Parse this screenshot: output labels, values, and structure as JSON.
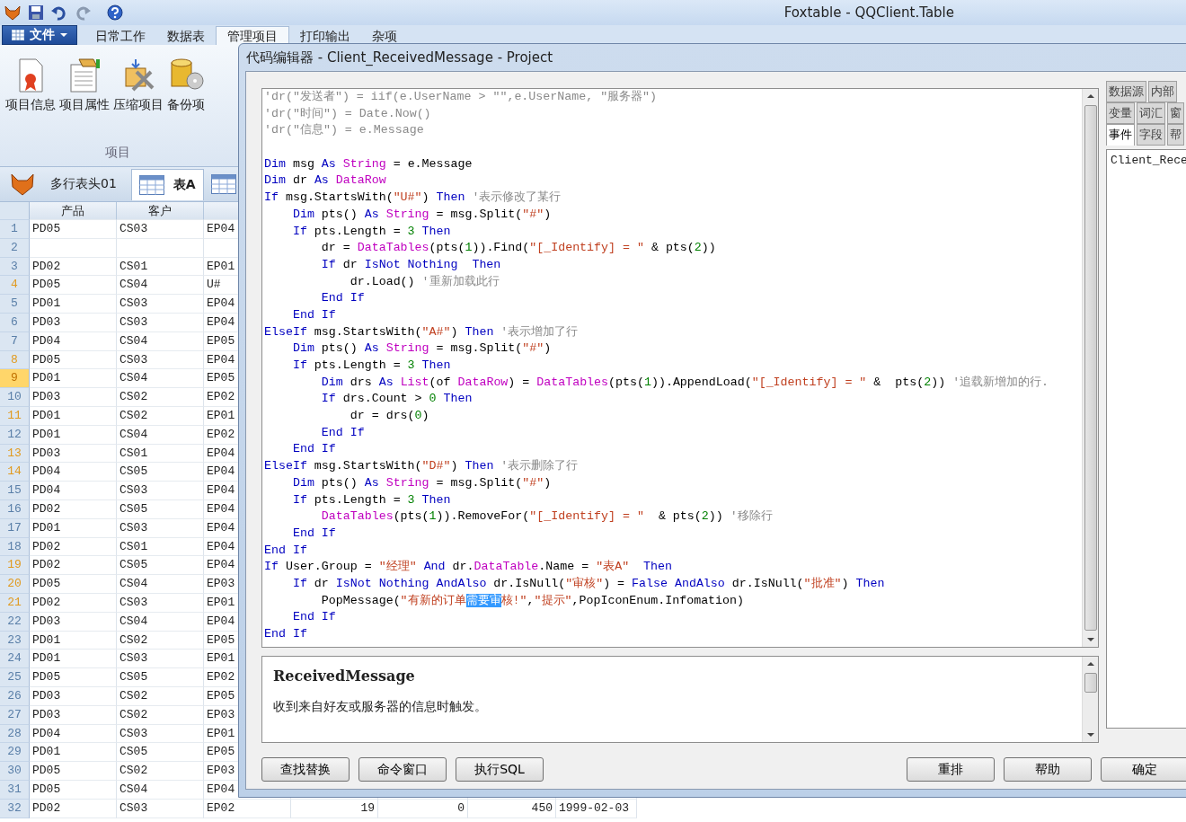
{
  "app": {
    "title": "Foxtable - QQClient.Table",
    "file_menu": "文件"
  },
  "ribbon_tabs": [
    {
      "label": "日常工作",
      "selected": false
    },
    {
      "label": "数据表",
      "selected": false
    },
    {
      "label": "管理项目",
      "selected": true
    },
    {
      "label": "打印输出",
      "selected": false
    },
    {
      "label": "杂项",
      "selected": false
    }
  ],
  "ribbon_group": {
    "label": "项目",
    "buttons": [
      "项目信息",
      "项目属性",
      "压缩项目",
      "备份项"
    ]
  },
  "table_tabs": [
    {
      "label": "多行表头01",
      "selected": false
    },
    {
      "label": "表A",
      "selected": true
    }
  ],
  "grid": {
    "columns": [
      "产品",
      "客户"
    ],
    "rows": [
      {
        "number": "1",
        "marked": false,
        "selected": false,
        "cells": [
          "PD05",
          "CS03",
          "EP04"
        ]
      },
      {
        "number": "2",
        "marked": false,
        "selected": false,
        "cells": []
      },
      {
        "number": "3",
        "marked": false,
        "selected": false,
        "cells": [
          "PD02",
          "CS01",
          "EP01"
        ]
      },
      {
        "number": "4",
        "marked": true,
        "selected": false,
        "cells": [
          "PD05",
          "CS04",
          "U#"
        ]
      },
      {
        "number": "5",
        "marked": false,
        "selected": false,
        "cells": [
          "PD01",
          "CS03",
          "EP04"
        ]
      },
      {
        "number": "6",
        "marked": false,
        "selected": false,
        "cells": [
          "PD03",
          "CS03",
          "EP04"
        ]
      },
      {
        "number": "7",
        "marked": false,
        "selected": false,
        "cells": [
          "PD04",
          "CS04",
          "EP05"
        ]
      },
      {
        "number": "8",
        "marked": true,
        "selected": false,
        "cells": [
          "PD05",
          "CS03",
          "EP04"
        ]
      },
      {
        "number": "9",
        "marked": true,
        "selected": true,
        "cells": [
          "PD01",
          "CS04",
          "EP05"
        ]
      },
      {
        "number": "10",
        "marked": false,
        "selected": false,
        "cells": [
          "PD03",
          "CS02",
          "EP02"
        ]
      },
      {
        "number": "11",
        "marked": true,
        "selected": false,
        "cells": [
          "PD01",
          "CS02",
          "EP01"
        ]
      },
      {
        "number": "12",
        "marked": false,
        "selected": false,
        "cells": [
          "PD01",
          "CS04",
          "EP02"
        ]
      },
      {
        "number": "13",
        "marked": true,
        "selected": false,
        "cells": [
          "PD03",
          "CS01",
          "EP04"
        ]
      },
      {
        "number": "14",
        "marked": true,
        "selected": false,
        "cells": [
          "PD04",
          "CS05",
          "EP04"
        ]
      },
      {
        "number": "15",
        "marked": false,
        "selected": false,
        "cells": [
          "PD04",
          "CS03",
          "EP04"
        ]
      },
      {
        "number": "16",
        "marked": false,
        "selected": false,
        "cells": [
          "PD02",
          "CS05",
          "EP04"
        ]
      },
      {
        "number": "17",
        "marked": false,
        "selected": false,
        "cells": [
          "PD01",
          "CS03",
          "EP04"
        ]
      },
      {
        "number": "18",
        "marked": false,
        "selected": false,
        "cells": [
          "PD02",
          "CS01",
          "EP04"
        ]
      },
      {
        "number": "19",
        "marked": true,
        "selected": false,
        "cells": [
          "PD02",
          "CS05",
          "EP04"
        ]
      },
      {
        "number": "20",
        "marked": true,
        "selected": false,
        "cells": [
          "PD05",
          "CS04",
          "EP03"
        ]
      },
      {
        "number": "21",
        "marked": true,
        "selected": false,
        "cells": [
          "PD02",
          "CS03",
          "EP01"
        ]
      },
      {
        "number": "22",
        "marked": false,
        "selected": false,
        "cells": [
          "PD03",
          "CS04",
          "EP04"
        ]
      },
      {
        "number": "23",
        "marked": false,
        "selected": false,
        "cells": [
          "PD01",
          "CS02",
          "EP05"
        ]
      },
      {
        "number": "24",
        "marked": false,
        "selected": false,
        "cells": [
          "PD01",
          "CS03",
          "EP01"
        ]
      },
      {
        "number": "25",
        "marked": false,
        "selected": false,
        "cells": [
          "PD05",
          "CS05",
          "EP02"
        ]
      },
      {
        "number": "26",
        "marked": false,
        "selected": false,
        "cells": [
          "PD03",
          "CS02",
          "EP05"
        ]
      },
      {
        "number": "27",
        "marked": false,
        "selected": false,
        "cells": [
          "PD03",
          "CS02",
          "EP03"
        ]
      },
      {
        "number": "28",
        "marked": false,
        "selected": false,
        "cells": [
          "PD04",
          "CS03",
          "EP01"
        ]
      },
      {
        "number": "29",
        "marked": false,
        "selected": false,
        "cells": [
          "PD01",
          "CS05",
          "EP05"
        ]
      },
      {
        "number": "30",
        "marked": false,
        "selected": false,
        "cells": [
          "PD05",
          "CS02",
          "EP03"
        ]
      },
      {
        "number": "31",
        "marked": false,
        "selected": false,
        "cells": [
          "PD05",
          "CS04",
          "EP04"
        ]
      },
      {
        "number": "32",
        "marked": false,
        "selected": false,
        "cells": [
          "PD02",
          "CS03",
          "EP02",
          "19",
          "0",
          "450",
          "1999-02-03"
        ]
      }
    ]
  },
  "dialog": {
    "title": "代码编辑器 - Client_ReceivedMessage - Project",
    "code_lines": [
      {
        "kind": "code",
        "tokens": [
          {
            "text": "'dr(\"发送者\") = iif(e.UserName > \"\",e.UserName, \"服务器\")",
            "kind": "comment"
          }
        ]
      },
      {
        "kind": "code",
        "tokens": [
          {
            "text": "'dr(\"时间\") = Date.Now()",
            "kind": "comment"
          }
        ]
      },
      {
        "kind": "code",
        "tokens": [
          {
            "text": "'dr(\"信息\") = e.Message",
            "kind": "comment"
          }
        ]
      },
      {
        "kind": "blank"
      },
      {
        "kind": "code",
        "tokens": [
          {
            "text": "Dim",
            "kind": "keyword"
          },
          {
            "text": " msg ",
            "kind": "plain"
          },
          {
            "text": "As",
            "kind": "keyword"
          },
          {
            "text": " String",
            "kind": "type"
          },
          {
            "text": " = e.Message",
            "kind": "plain"
          }
        ]
      },
      {
        "kind": "code",
        "tokens": [
          {
            "text": "Dim",
            "kind": "keyword"
          },
          {
            "text": " dr ",
            "kind": "plain"
          },
          {
            "text": "As",
            "kind": "keyword"
          },
          {
            "text": " DataRow",
            "kind": "type"
          }
        ]
      },
      {
        "kind": "code",
        "tokens": [
          {
            "text": "If",
            "kind": "keyword"
          },
          {
            "text": " msg.StartsWith(",
            "kind": "plain"
          },
          {
            "text": "\"U#\"",
            "kind": "string"
          },
          {
            "text": ")",
            "kind": "plain"
          },
          {
            "text": " Then",
            "kind": "keyword"
          },
          {
            "text": " '表示修改了某行",
            "kind": "comment"
          }
        ]
      },
      {
        "kind": "code",
        "tokens": [
          {
            "text": "    Dim",
            "kind": "keyword"
          },
          {
            "text": " pts() ",
            "kind": "plain"
          },
          {
            "text": "As",
            "kind": "keyword"
          },
          {
            "text": " String",
            "kind": "type"
          },
          {
            "text": " = msg.Split(",
            "kind": "plain"
          },
          {
            "text": "\"#\"",
            "kind": "string"
          },
          {
            "text": ")",
            "kind": "plain"
          }
        ]
      },
      {
        "kind": "code",
        "tokens": [
          {
            "text": "    If",
            "kind": "keyword"
          },
          {
            "text": " pts.Length = ",
            "kind": "plain"
          },
          {
            "text": "3",
            "kind": "number"
          },
          {
            "text": " Then",
            "kind": "keyword"
          }
        ]
      },
      {
        "kind": "code",
        "tokens": [
          {
            "text": "        dr = ",
            "kind": "plain"
          },
          {
            "text": "DataTables",
            "kind": "type"
          },
          {
            "text": "(pts(",
            "kind": "plain"
          },
          {
            "text": "1",
            "kind": "number"
          },
          {
            "text": ")).Find(",
            "kind": "plain"
          },
          {
            "text": "\"[_Identify] = \"",
            "kind": "string"
          },
          {
            "text": " & pts(",
            "kind": "plain"
          },
          {
            "text": "2",
            "kind": "number"
          },
          {
            "text": "))",
            "kind": "plain"
          }
        ]
      },
      {
        "kind": "code",
        "tokens": [
          {
            "text": "        If",
            "kind": "keyword"
          },
          {
            "text": " dr ",
            "kind": "plain"
          },
          {
            "text": "IsNot Nothing  Then",
            "kind": "keyword"
          }
        ]
      },
      {
        "kind": "code",
        "tokens": [
          {
            "text": "            dr.Load() ",
            "kind": "plain"
          },
          {
            "text": "'重新加载此行",
            "kind": "comment"
          }
        ]
      },
      {
        "kind": "code",
        "tokens": [
          {
            "text": "        End If",
            "kind": "keyword"
          }
        ]
      },
      {
        "kind": "code",
        "tokens": [
          {
            "text": "    End If",
            "kind": "keyword"
          }
        ]
      },
      {
        "kind": "code",
        "tokens": [
          {
            "text": "ElseIf",
            "kind": "keyword"
          },
          {
            "text": " msg.StartsWith(",
            "kind": "plain"
          },
          {
            "text": "\"A#\"",
            "kind": "string"
          },
          {
            "text": ") ",
            "kind": "plain"
          },
          {
            "text": "Then",
            "kind": "keyword"
          },
          {
            "text": " '表示增加了行",
            "kind": "comment"
          }
        ]
      },
      {
        "kind": "code",
        "tokens": [
          {
            "text": "    Dim",
            "kind": "keyword"
          },
          {
            "text": " pts() ",
            "kind": "plain"
          },
          {
            "text": "As",
            "kind": "keyword"
          },
          {
            "text": " String",
            "kind": "type"
          },
          {
            "text": " = msg.Split(",
            "kind": "plain"
          },
          {
            "text": "\"#\"",
            "kind": "string"
          },
          {
            "text": ")",
            "kind": "plain"
          }
        ]
      },
      {
        "kind": "code",
        "tokens": [
          {
            "text": "    If",
            "kind": "keyword"
          },
          {
            "text": " pts.Length = ",
            "kind": "plain"
          },
          {
            "text": "3",
            "kind": "number"
          },
          {
            "text": " Then",
            "kind": "keyword"
          }
        ]
      },
      {
        "kind": "code",
        "tokens": [
          {
            "text": "        Dim",
            "kind": "keyword"
          },
          {
            "text": " drs ",
            "kind": "plain"
          },
          {
            "text": "As",
            "kind": "keyword"
          },
          {
            "text": " List",
            "kind": "type"
          },
          {
            "text": "(of ",
            "kind": "plain"
          },
          {
            "text": "DataRow",
            "kind": "type"
          },
          {
            "text": ") = ",
            "kind": "plain"
          },
          {
            "text": "DataTables",
            "kind": "type"
          },
          {
            "text": "(pts(",
            "kind": "plain"
          },
          {
            "text": "1",
            "kind": "number"
          },
          {
            "text": ")).AppendLoad(",
            "kind": "plain"
          },
          {
            "text": "\"[_Identify] = \"",
            "kind": "string"
          },
          {
            "text": " &  pts(",
            "kind": "plain"
          },
          {
            "text": "2",
            "kind": "number"
          },
          {
            "text": ")) ",
            "kind": "plain"
          },
          {
            "text": "'追载新增加的行.",
            "kind": "comment"
          }
        ]
      },
      {
        "kind": "code",
        "tokens": [
          {
            "text": "        If",
            "kind": "keyword"
          },
          {
            "text": " drs.Count > ",
            "kind": "plain"
          },
          {
            "text": "0",
            "kind": "number"
          },
          {
            "text": " Then",
            "kind": "keyword"
          }
        ]
      },
      {
        "kind": "code",
        "tokens": [
          {
            "text": "            dr = drs(",
            "kind": "plain"
          },
          {
            "text": "0",
            "kind": "number"
          },
          {
            "text": ")",
            "kind": "plain"
          }
        ]
      },
      {
        "kind": "code",
        "tokens": [
          {
            "text": "        End If",
            "kind": "keyword"
          }
        ]
      },
      {
        "kind": "code",
        "tokens": [
          {
            "text": "    End If",
            "kind": "keyword"
          }
        ]
      },
      {
        "kind": "code",
        "tokens": [
          {
            "text": "ElseIf",
            "kind": "keyword"
          },
          {
            "text": " msg.StartsWith(",
            "kind": "plain"
          },
          {
            "text": "\"D#\"",
            "kind": "string"
          },
          {
            "text": ") ",
            "kind": "plain"
          },
          {
            "text": "Then",
            "kind": "keyword"
          },
          {
            "text": " '表示删除了行",
            "kind": "comment"
          }
        ]
      },
      {
        "kind": "code",
        "tokens": [
          {
            "text": "    Dim",
            "kind": "keyword"
          },
          {
            "text": " pts() ",
            "kind": "plain"
          },
          {
            "text": "As",
            "kind": "keyword"
          },
          {
            "text": " String",
            "kind": "type"
          },
          {
            "text": " = msg.Split(",
            "kind": "plain"
          },
          {
            "text": "\"#\"",
            "kind": "string"
          },
          {
            "text": ")",
            "kind": "plain"
          }
        ]
      },
      {
        "kind": "code",
        "tokens": [
          {
            "text": "    If",
            "kind": "keyword"
          },
          {
            "text": " pts.Length = ",
            "kind": "plain"
          },
          {
            "text": "3",
            "kind": "number"
          },
          {
            "text": " Then",
            "kind": "keyword"
          }
        ]
      },
      {
        "kind": "code",
        "tokens": [
          {
            "text": "        DataTables",
            "kind": "type"
          },
          {
            "text": "(pts(",
            "kind": "plain"
          },
          {
            "text": "1",
            "kind": "number"
          },
          {
            "text": ")).RemoveFor(",
            "kind": "plain"
          },
          {
            "text": "\"[_Identify] = \"",
            "kind": "string"
          },
          {
            "text": "  & pts(",
            "kind": "plain"
          },
          {
            "text": "2",
            "kind": "number"
          },
          {
            "text": ")) ",
            "kind": "plain"
          },
          {
            "text": "'移除行",
            "kind": "comment"
          }
        ]
      },
      {
        "kind": "code",
        "tokens": [
          {
            "text": "    End If",
            "kind": "keyword"
          }
        ]
      },
      {
        "kind": "code",
        "tokens": [
          {
            "text": "End If",
            "kind": "keyword"
          }
        ]
      },
      {
        "kind": "code",
        "tokens": [
          {
            "text": "If",
            "kind": "keyword"
          },
          {
            "text": " User.Group = ",
            "kind": "plain"
          },
          {
            "text": "\"经理\"",
            "kind": "string"
          },
          {
            "text": " And",
            "kind": "keyword"
          },
          {
            "text": " dr.",
            "kind": "plain"
          },
          {
            "text": "DataTable",
            "kind": "type"
          },
          {
            "text": ".Name = ",
            "kind": "plain"
          },
          {
            "text": "\"表A\"",
            "kind": "string"
          },
          {
            "text": "  Then",
            "kind": "keyword"
          }
        ]
      },
      {
        "kind": "code",
        "tokens": [
          {
            "text": "    If",
            "kind": "keyword"
          },
          {
            "text": " dr ",
            "kind": "plain"
          },
          {
            "text": "IsNot Nothing AndAlso",
            "kind": "keyword"
          },
          {
            "text": " dr.IsNull(",
            "kind": "plain"
          },
          {
            "text": "\"审核\"",
            "kind": "string"
          },
          {
            "text": ") = ",
            "kind": "plain"
          },
          {
            "text": "False AndAlso",
            "kind": "keyword"
          },
          {
            "text": " dr.IsNull(",
            "kind": "plain"
          },
          {
            "text": "\"批准\"",
            "kind": "string"
          },
          {
            "text": ") ",
            "kind": "plain"
          },
          {
            "text": "Then",
            "kind": "keyword"
          }
        ]
      },
      {
        "kind": "code",
        "tokens": [
          {
            "text": "        PopMessage(",
            "kind": "plain"
          },
          {
            "text": "\"有新的订单",
            "kind": "string"
          },
          {
            "text": "需要审",
            "kind": "selection"
          },
          {
            "text": "核!\"",
            "kind": "string"
          },
          {
            "text": ",",
            "kind": "plain"
          },
          {
            "text": "\"提示\"",
            "kind": "string"
          },
          {
            "text": ",PopIconEnum.Infomation)",
            "kind": "plain"
          }
        ]
      },
      {
        "kind": "code",
        "tokens": [
          {
            "text": "    End If",
            "kind": "keyword"
          }
        ]
      },
      {
        "kind": "code",
        "tokens": [
          {
            "text": "End If",
            "kind": "keyword"
          }
        ]
      }
    ],
    "description": {
      "title": "ReceivedMessage",
      "text": "收到来自好友或服务器的信息时触发。"
    },
    "left_buttons": [
      "查找替换",
      "命令窗口",
      "执行SQL"
    ],
    "right_buttons": [
      "重排",
      "帮助",
      "确定"
    ],
    "side_tab_rows": [
      {
        "tabs": [
          {
            "label": "数据源",
            "selected": false
          },
          {
            "label": "内部",
            "selected": false
          }
        ]
      },
      {
        "tabs": [
          {
            "label": "变量",
            "selected": false
          },
          {
            "label": "词汇",
            "selected": false
          },
          {
            "label": "窗",
            "selected": false
          }
        ]
      },
      {
        "tabs": [
          {
            "label": "事件",
            "selected": true
          },
          {
            "label": "字段",
            "selected": false
          },
          {
            "label": "帮",
            "selected": false
          }
        ]
      }
    ],
    "side_list": [
      "Client_Rece"
    ]
  }
}
